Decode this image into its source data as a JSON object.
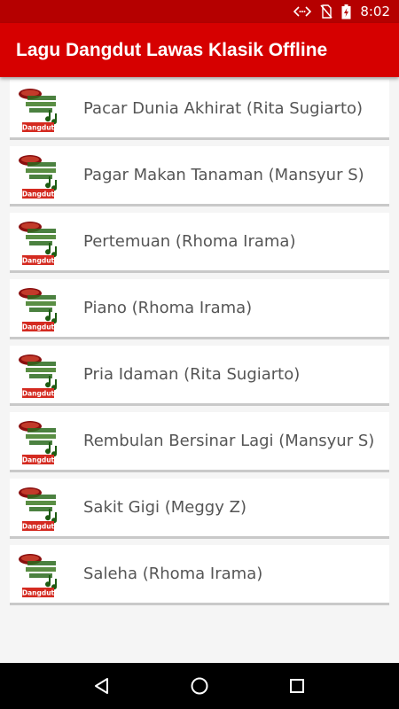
{
  "status_bar": {
    "time": "8:02",
    "icons": [
      "data-transfer-icon",
      "no-sim-icon",
      "battery-charging-icon"
    ]
  },
  "app_bar": {
    "title": "Lagu Dangdut Lawas Klasik Offline",
    "color": "#d60000"
  },
  "songs": [
    {
      "title": "Pacar Dunia Akhirat (Rita Sugiarto)",
      "thumb_label": "Dangdut"
    },
    {
      "title": "Pagar Makan Tanaman (Mansyur S)",
      "thumb_label": "Dangdut"
    },
    {
      "title": "Pertemuan (Rhoma Irama)",
      "thumb_label": "Dangdut"
    },
    {
      "title": "Piano (Rhoma Irama)",
      "thumb_label": "Dangdut"
    },
    {
      "title": "Pria Idaman (Rita Sugiarto)",
      "thumb_label": "Dangdut"
    },
    {
      "title": "Rembulan Bersinar Lagi (Mansyur S)",
      "thumb_label": "Dangdut"
    },
    {
      "title": "Sakit Gigi (Meggy Z)",
      "thumb_label": "Dangdut"
    },
    {
      "title": "Saleha (Rhoma Irama)",
      "thumb_label": "Dangdut"
    }
  ],
  "nav_bar": {
    "icons": [
      "back-icon",
      "home-icon",
      "recents-icon"
    ]
  }
}
